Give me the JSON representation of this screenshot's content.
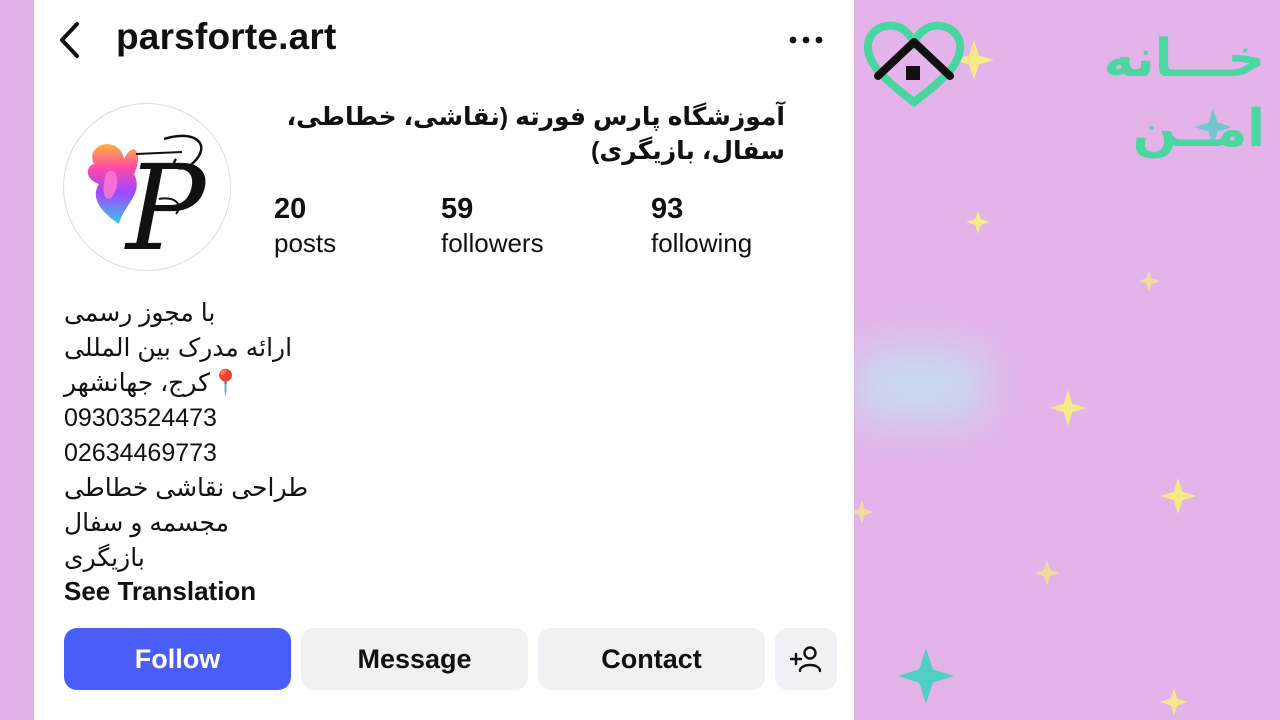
{
  "header": {
    "username": "parsforte.art",
    "back_icon": "chevron-left-icon",
    "more_icon": "more-horizontal-icon"
  },
  "profile": {
    "full_name": "آموزشگاه پارس فورته (نقاشی، خطاطی، سفال، بازیگری)",
    "stats": [
      {
        "value": "20",
        "label": "posts"
      },
      {
        "value": "59",
        "label": "followers"
      },
      {
        "value": "93",
        "label": "following"
      }
    ]
  },
  "bio": {
    "lines": [
      "با مجوز رسمی",
      "ارائه مدرک بین المللی",
      "📍کرج، جهانشهر",
      "09303524473",
      "02634469773",
      "طراحی نقاشی خطاطی",
      "مجسمه و سفال",
      "بازیگری"
    ],
    "translate_label": "See Translation"
  },
  "actions": {
    "follow": "Follow",
    "message": "Message",
    "contact": "Contact",
    "add_person_icon": "add-person-icon"
  },
  "watermark": {
    "text": "خـــانه امــن"
  },
  "colors": {
    "follow_blue": "#4a5df9",
    "secondary_button": "#eff1f5",
    "background_pink": "#e2b2e8",
    "watermark_green": "#4bd7a0"
  }
}
